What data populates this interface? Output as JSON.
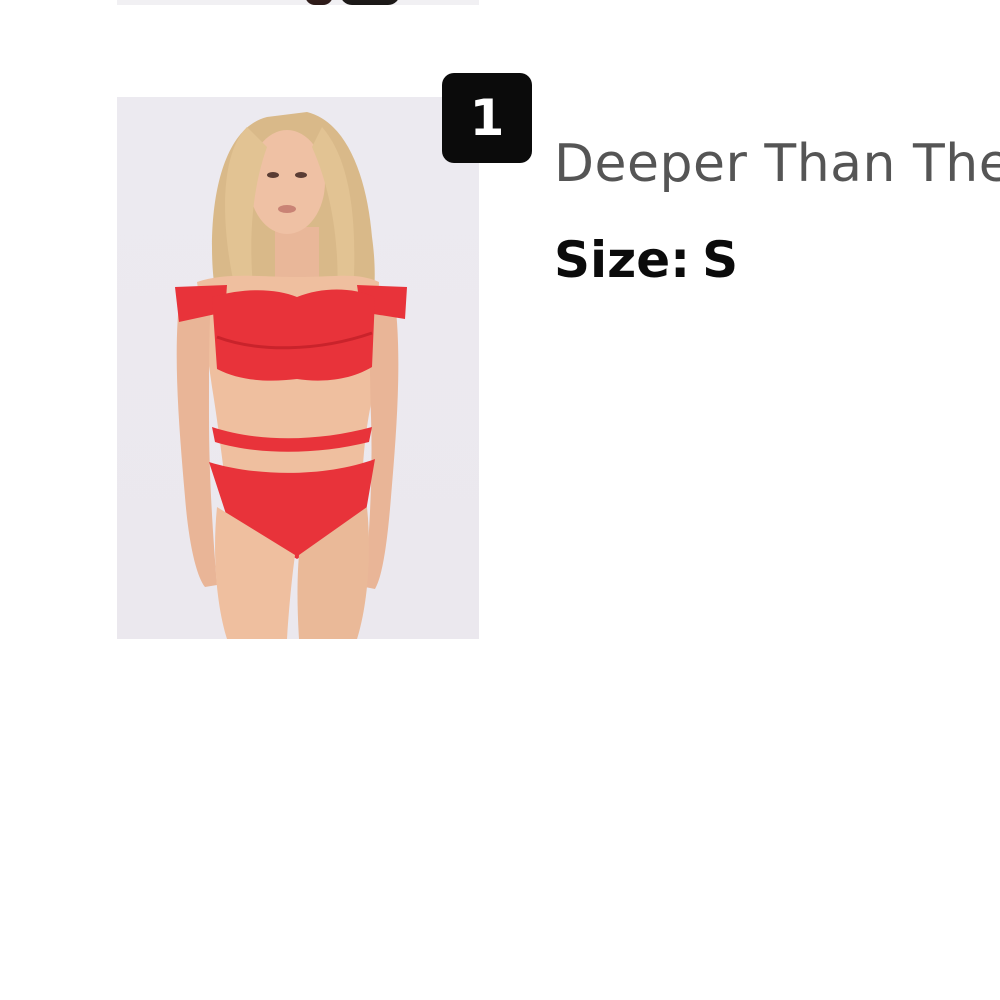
{
  "cart_item": {
    "quantity": "1",
    "name": "Deeper Than The Ocean Bikini - Red",
    "size_label": "Size:",
    "size_value": "S",
    "thumbnail_icon": "product-photo-red-bikini"
  },
  "colors": {
    "badge_background": "#0b0b0b",
    "name_text": "#555555",
    "size_text": "#0b0b0b",
    "swimsuit": "#e8333a"
  }
}
